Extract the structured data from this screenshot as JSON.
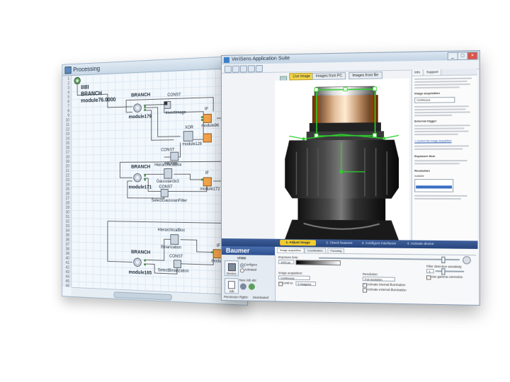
{
  "processing": {
    "title": "Processing",
    "line_numbers": [
      "1",
      "2",
      "3",
      "4",
      "5",
      "6",
      "7",
      "8",
      "9",
      "10",
      "11",
      "12",
      "13",
      "14",
      "15",
      "16",
      "17",
      "18",
      "19",
      "20",
      "21",
      "22",
      "23",
      "24",
      "25",
      "26",
      "27",
      "28",
      "29",
      "30",
      "31",
      "32",
      "33",
      "34",
      "35",
      "36",
      "37",
      "38",
      "39",
      "40",
      "41",
      "42",
      "43",
      "44",
      "45",
      "46"
    ],
    "start_node": {
      "line1": "IIIIII",
      "line2": "BRANCH",
      "line3": "module76.0000"
    },
    "labels": {
      "branch1": "BRANCH",
      "module179": "module179",
      "const1": "CONST",
      "invertimage": "InvertImage",
      "if1": "IF",
      "module96": "module96",
      "xor": "XOR",
      "module128": "module128",
      "const2": "CONST",
      "allones": "AllOnes",
      "branch2": "BRANCH",
      "module171": "module171",
      "hbox1": "HierarchicalBox",
      "gaussian": "Gaussian3x3",
      "if2": "IF",
      "module172": "module172",
      "const3": "CONST",
      "selectgauss": "SelectGaussianFilter",
      "hbox2": "HierarchicalBox",
      "binarization": "Binarization",
      "branch3": "BRANCH",
      "module165": "module165",
      "const4": "CONST",
      "selectbin": "SelectBinarization",
      "if3": "IF",
      "module167": "module167"
    }
  },
  "app": {
    "title": "VeriSens Application Suite",
    "image_tabs": [
      "Live image",
      "Images from PC",
      "Images from file"
    ],
    "right_panel": {
      "tabs": [
        "Info",
        "Support"
      ],
      "heading_acquisition": "Image acquisition",
      "heading_continuous": "Continuous",
      "heading_external": "External trigger",
      "link": "> Control the image acquisition",
      "heading_exposure": "Exposure time",
      "heading_resolution": "Resolution",
      "list_label": "Available"
    },
    "workflow": [
      "1. Adjust image",
      "2. Check features",
      "3. Configure interfaces",
      "4. Activate device"
    ],
    "brand": "Baumer",
    "nav": {
      "device_label": "Device",
      "device_id": "VF800",
      "configure": "Configure",
      "activated": "Activated",
      "job_label": "Job",
      "job_name": "New Job abc",
      "permission": "Permission Rights:",
      "deactivated": "Deactivated"
    },
    "settings": {
      "tabs": [
        "Image acquisition",
        "Coordination",
        "Focusing"
      ],
      "exposure_label": "Exposure time:",
      "exposure_value": "1000 µs",
      "acquisition_label": "Image acquisition:",
      "acquisition_value": "Continuous",
      "limit_label": "Limit to:",
      "limit_value": "5 Images/s",
      "resolution_label": "Resolution:",
      "resolution_value": "Full resolution",
      "illum_internal": "Activate internal illumination",
      "illum_external": "Activate external illumination",
      "filter_label": "Filter detection sensitivity",
      "filter_value": "4",
      "gain_label": "Use gamma correction"
    }
  }
}
